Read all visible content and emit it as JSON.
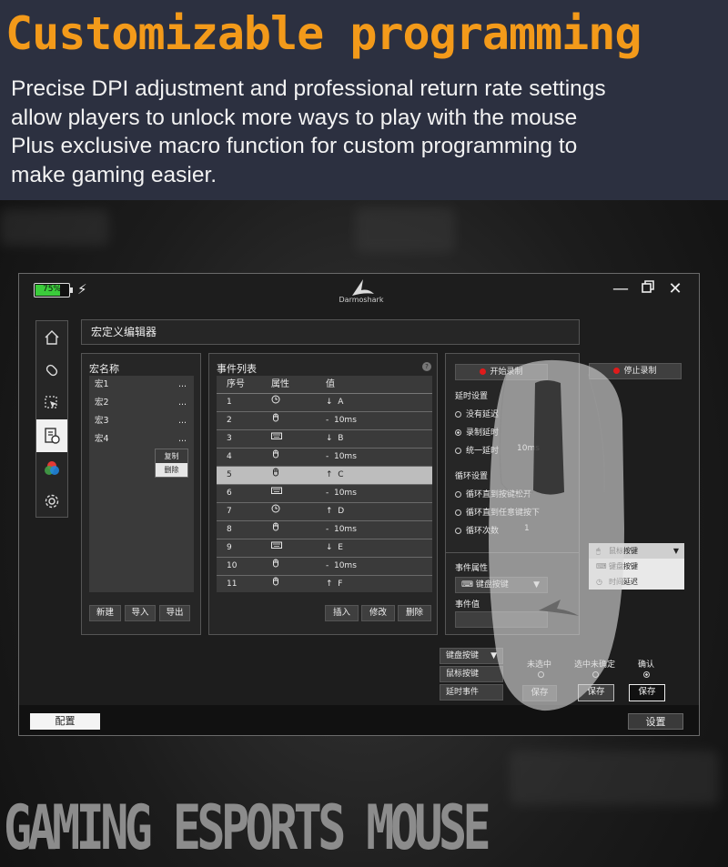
{
  "promo": {
    "headline": "Customizable programming",
    "lines": [
      "Precise DPI adjustment and professional return rate settings",
      "allow players to unlock more ways to play with the mouse",
      "Plus exclusive macro function for custom programming to",
      "make gaming easier."
    ]
  },
  "window": {
    "battery": {
      "label": "75%",
      "level": 0.75
    },
    "brand": "Darmoshark",
    "controls": [
      "minimize",
      "restore",
      "close"
    ]
  },
  "nav": [
    "home-icon",
    "mouse-icon",
    "pointer-icon",
    "macro-icon",
    "rgb-icon",
    "gear-icon"
  ],
  "editor": {
    "title": "宏定义编辑器",
    "macro_panel": {
      "title": "宏名称",
      "items": [
        "宏1",
        "宏2",
        "宏3",
        "宏4"
      ],
      "dots": "...",
      "context_menu": [
        "复制",
        "删除"
      ],
      "buttons": [
        "新建",
        "导入",
        "导出"
      ]
    },
    "event_panel": {
      "title": "事件列表",
      "help": "?",
      "headers": [
        "序号",
        "属性",
        "值"
      ],
      "rows": [
        {
          "n": "1",
          "type": "clock",
          "arrow": "↓",
          "value": "A"
        },
        {
          "n": "2",
          "type": "mouse",
          "arrow": "-",
          "value": "10ms"
        },
        {
          "n": "3",
          "type": "keyboard",
          "arrow": "↓",
          "value": "B"
        },
        {
          "n": "4",
          "type": "mouse",
          "arrow": "-",
          "value": "10ms"
        },
        {
          "n": "5",
          "type": "mouse",
          "arrow": "↑",
          "value": "C"
        },
        {
          "n": "6",
          "type": "keyboard",
          "arrow": "-",
          "value": "10ms"
        },
        {
          "n": "7",
          "type": "clock",
          "arrow": "↑",
          "value": "D"
        },
        {
          "n": "8",
          "type": "mouse",
          "arrow": "-",
          "value": "10ms"
        },
        {
          "n": "9",
          "type": "keyboard",
          "arrow": "↓",
          "value": "E"
        },
        {
          "n": "10",
          "type": "mouse",
          "arrow": "-",
          "value": "10ms"
        },
        {
          "n": "11",
          "type": "mouse",
          "arrow": "↑",
          "value": "F"
        }
      ],
      "selected_row": 5,
      "buttons": [
        "插入",
        "修改",
        "删除"
      ]
    },
    "settings": {
      "start_record": "开始录制",
      "stop_record": "停止录制",
      "delay_title": "延时设置",
      "delay_options": [
        "没有延迟",
        "录制延时",
        "统一延时"
      ],
      "delay_selected": 1,
      "delay_value": "10ms",
      "loop_title": "循环设置",
      "loop_options": [
        "循环直到按键松开",
        "循环直到任意键按下",
        "循环次数"
      ],
      "loop_count": "1",
      "event_attr_title": "事件属性",
      "event_attr_value": "键盘按键",
      "event_value_title": "事件值"
    },
    "popup_options": [
      "鼠标按键",
      "键盘按键",
      "时间延迟"
    ],
    "lower": {
      "dropdown": "键盘按键",
      "options": [
        "鼠标按键",
        "延时事件"
      ],
      "radio_labels": [
        "未选中",
        "选中未确定",
        "确认"
      ],
      "radio_selected": 2,
      "save_buttons": [
        "保存",
        "保存",
        "保存"
      ]
    }
  },
  "bottom": {
    "left_button": "配置",
    "right_button": "设置"
  },
  "tagline": "GAMING ESPORTS MOUSE",
  "colors": {
    "headline": "#f39a1a",
    "record_dot": "#e01b1b",
    "battery": "#3bcc3b"
  }
}
